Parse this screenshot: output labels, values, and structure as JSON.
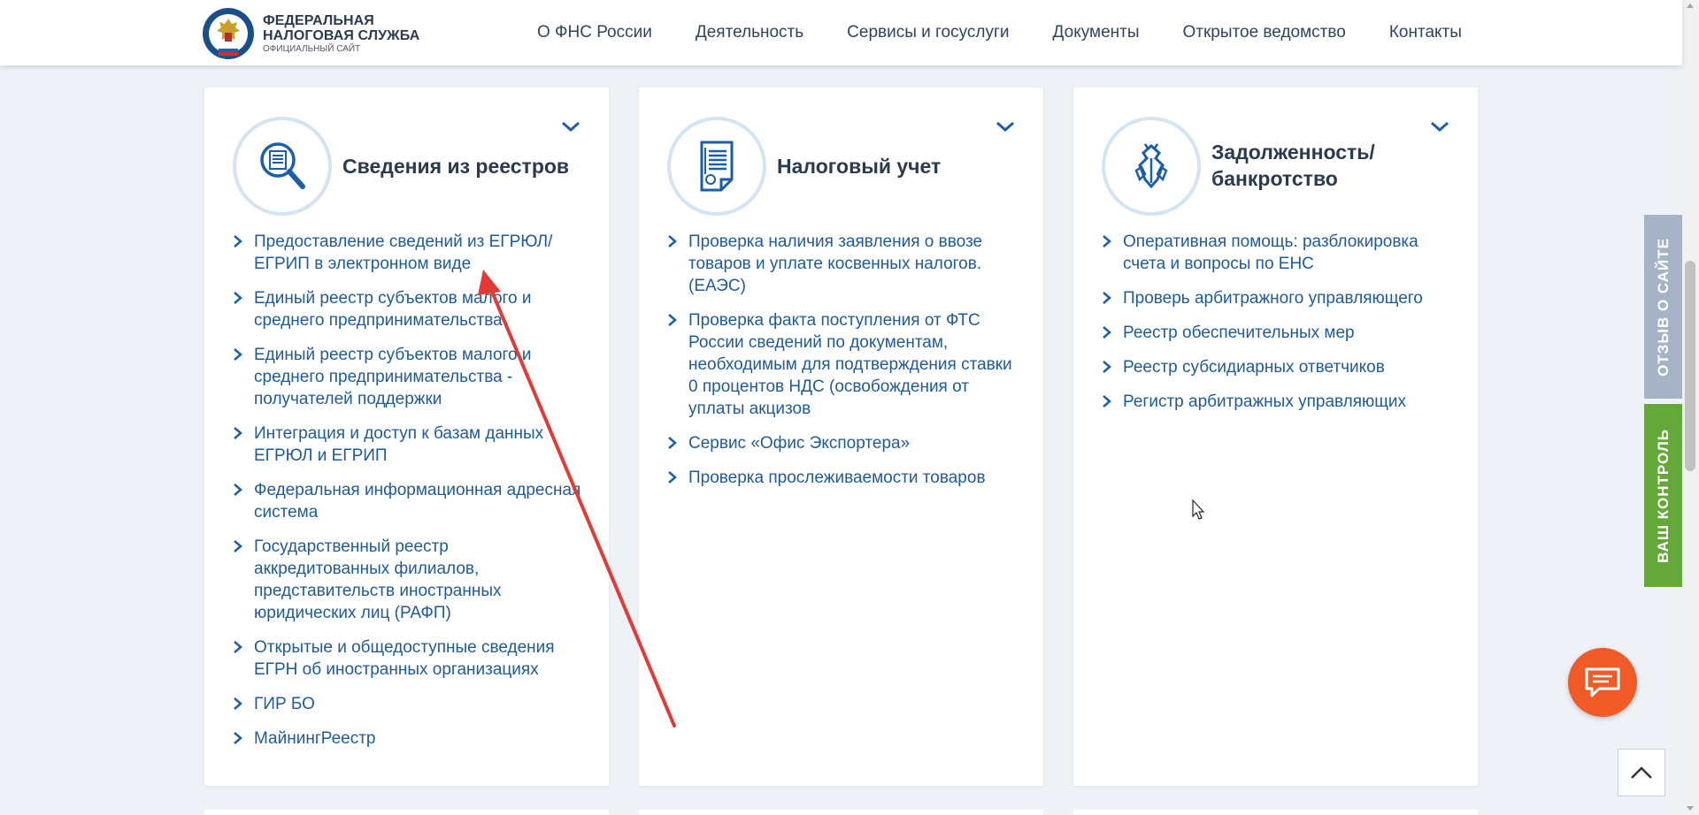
{
  "header": {
    "logo_line1": "ФЕДЕРАЛЬНАЯ",
    "logo_line2": "НАЛОГОВАЯ СЛУЖБА",
    "logo_sub": "ОФИЦИАЛЬНЫЙ САЙТ",
    "nav": [
      "О ФНС России",
      "Деятельность",
      "Сервисы и госуслуги",
      "Документы",
      "Открытое ведомство",
      "Контакты"
    ]
  },
  "cards": [
    {
      "icon": "registry-search-icon",
      "title": "Сведения из реестров",
      "links": [
        "Предоставление сведений из ЕГРЮЛ/ЕГРИП в электронном виде",
        "Единый реестр субъектов малого и среднего предпринимательства",
        "Единый реестр субъектов малого и среднего предпринимательства - получателей поддержки",
        "Интеграция и доступ к базам данных ЕГРЮЛ и ЕГРИП",
        "Федеральная информационная адресная система",
        "Государственный реестр аккредитованных филиалов, представительств иностранных юридических лиц (РАФП)",
        "Открытые и общедоступные сведения ЕГРН об иностранных организациях",
        "ГИР БО",
        "МайнингРеестр"
      ]
    },
    {
      "icon": "tax-document-icon",
      "title": "Налоговый учет",
      "links": [
        "Проверка наличия заявления о ввозе товаров и уплате косвенных налогов. (ЕАЭС)",
        "Проверка факта поступления от ФТС России сведений по документам, необходимым для подтверждения ставки 0 процентов НДС (освобождения от уплаты акцизов",
        "Сервис «Офис Экспортера»",
        "Проверка прослеживаемости товаров"
      ]
    },
    {
      "icon": "debt-bankruptcy-icon",
      "title_line1": "Задолженность/",
      "title_line2": "банкротство",
      "links": [
        "Оперативная помощь: разблокировка счета и вопросы по ЕНС",
        "Проверь арбитражного управляющего",
        "Реестр обеспечительных мер",
        "Реестр субсидиарных ответчиков",
        "Регистр арбитражных управляющих"
      ]
    }
  ],
  "side_tabs": {
    "feedback": "ОТЗЫВ О САЙТЕ",
    "control": "ВАШ КОНТРОЛЬ"
  },
  "colors": {
    "link": "#1f5a99",
    "chat_button": "#ef5a27",
    "feedback_tab": "#a6b3c4",
    "control_tab": "#64a83a",
    "annotation_arrow": "#e53935"
  }
}
